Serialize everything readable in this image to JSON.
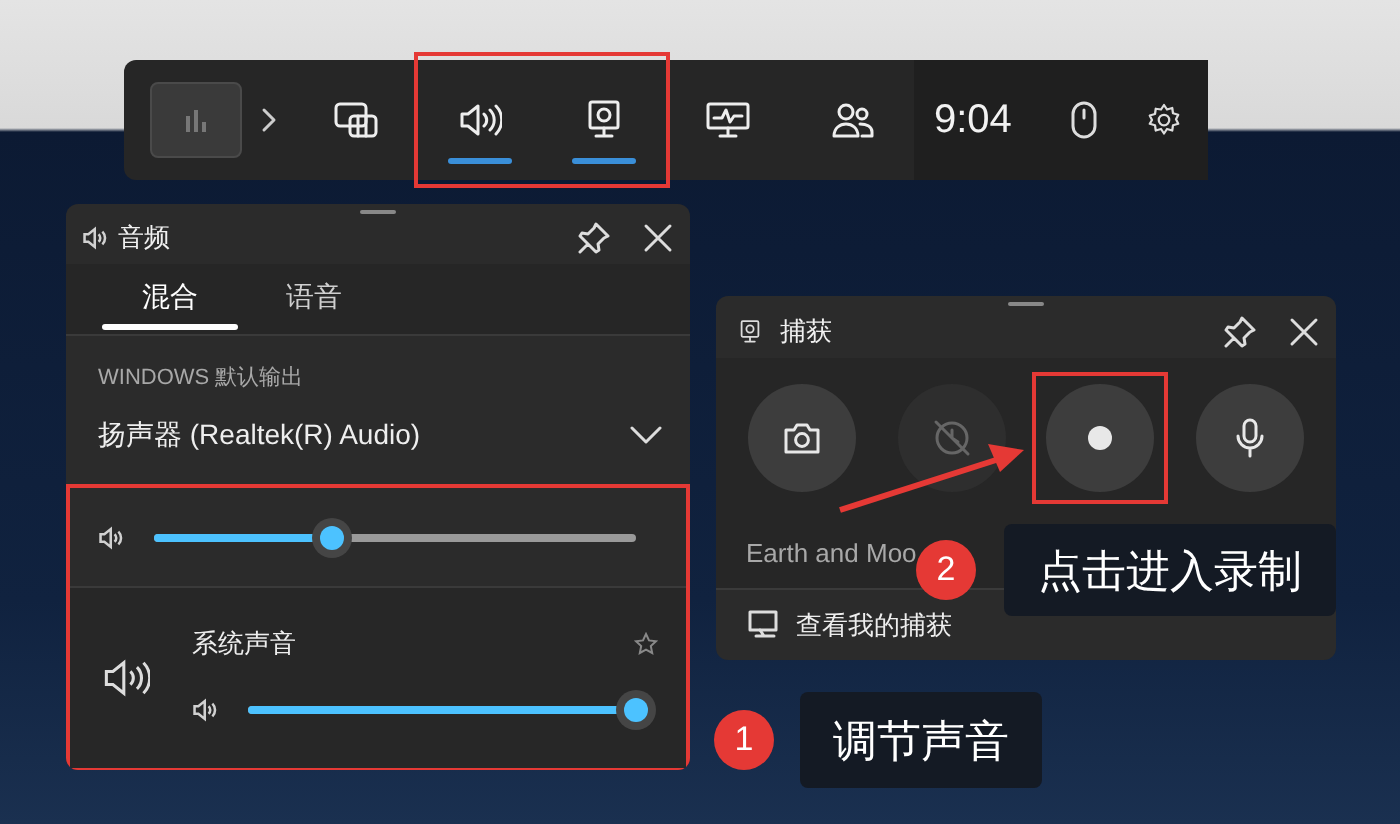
{
  "game_bar": {
    "items": [
      {
        "kind": "thumbnail",
        "selected": false
      },
      {
        "kind": "chevron",
        "selected": false
      },
      {
        "kind": "widgets",
        "selected": false
      },
      {
        "kind": "audio",
        "selected": true
      },
      {
        "kind": "capture",
        "selected": true
      },
      {
        "kind": "performance",
        "selected": false
      },
      {
        "kind": "social",
        "selected": false
      }
    ],
    "time": "9:04",
    "tray": [
      {
        "kind": "mouse"
      },
      {
        "kind": "settings"
      }
    ]
  },
  "audio_panel": {
    "title": "音频",
    "tabs": [
      {
        "label": "混合",
        "selected": true
      },
      {
        "label": "语音",
        "selected": false
      }
    ],
    "section_label": "WINDOWS 默认输出",
    "device": "扬声器 (Realtek(R) Audio)",
    "master": {
      "level": 0.37
    },
    "apps": [
      {
        "name": "系统声音",
        "level": 1.0
      }
    ]
  },
  "capture_panel": {
    "title": "捕获",
    "buttons": [
      {
        "kind": "screenshot",
        "disabled": false,
        "selected": false
      },
      {
        "kind": "record-last",
        "disabled": true,
        "selected": false
      },
      {
        "kind": "record",
        "disabled": false,
        "selected": true
      },
      {
        "kind": "microphone",
        "disabled": false,
        "selected": false
      }
    ],
    "caption": "Earth and Moo",
    "link": "查看我的捕获"
  },
  "annotations": [
    {
      "number": "1",
      "text": "调节声音"
    },
    {
      "number": "2",
      "text": "点击进入录制"
    }
  ]
}
